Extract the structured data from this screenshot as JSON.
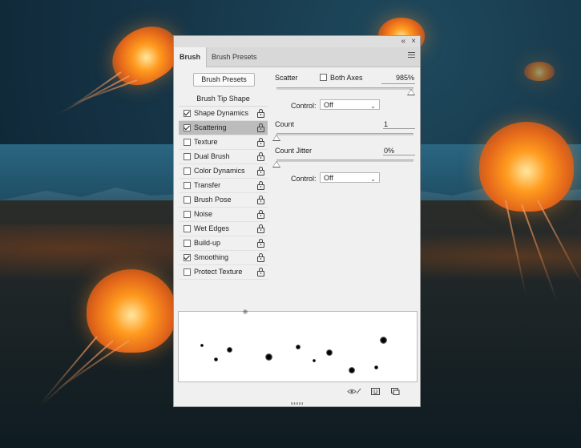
{
  "panel": {
    "titlebar": {
      "collapse_glyph": "«",
      "close_glyph": "×"
    },
    "tabs": [
      {
        "label": "Brush",
        "active": true
      },
      {
        "label": "Brush Presets",
        "active": false
      }
    ],
    "menu_icon": "hamburger-icon",
    "brush_presets_button": "Brush Presets",
    "list_header": "Brush Tip Shape",
    "items": [
      {
        "label": "Shape Dynamics",
        "checked": true,
        "selected": false
      },
      {
        "label": "Scattering",
        "checked": true,
        "selected": true
      },
      {
        "label": "Texture",
        "checked": false,
        "selected": false
      },
      {
        "label": "Dual Brush",
        "checked": false,
        "selected": false
      },
      {
        "label": "Color Dynamics",
        "checked": false,
        "selected": false
      },
      {
        "label": "Transfer",
        "checked": false,
        "selected": false
      },
      {
        "label": "Brush Pose",
        "checked": false,
        "selected": false
      },
      {
        "label": "Noise",
        "checked": false,
        "selected": false
      },
      {
        "label": "Wet Edges",
        "checked": false,
        "selected": false
      },
      {
        "label": "Build-up",
        "checked": false,
        "selected": false
      },
      {
        "label": "Smoothing",
        "checked": true,
        "selected": false
      },
      {
        "label": "Protect Texture",
        "checked": false,
        "selected": false
      }
    ],
    "scatter": {
      "label": "Scatter",
      "both_axes_label": "Both Axes",
      "both_axes_checked": false,
      "value": "985%",
      "slider_fraction": 0.985,
      "control_label": "Control:",
      "control_value": "Off"
    },
    "count": {
      "label": "Count",
      "value": "1",
      "slider_fraction": 0.0
    },
    "count_jitter": {
      "label": "Count Jitter",
      "value": "0%",
      "slider_fraction": 0.0,
      "control_label": "Control:",
      "control_value": "Off"
    },
    "footer_icons": [
      "eye-icon",
      "grid-icon",
      "new-preset-icon"
    ]
  }
}
